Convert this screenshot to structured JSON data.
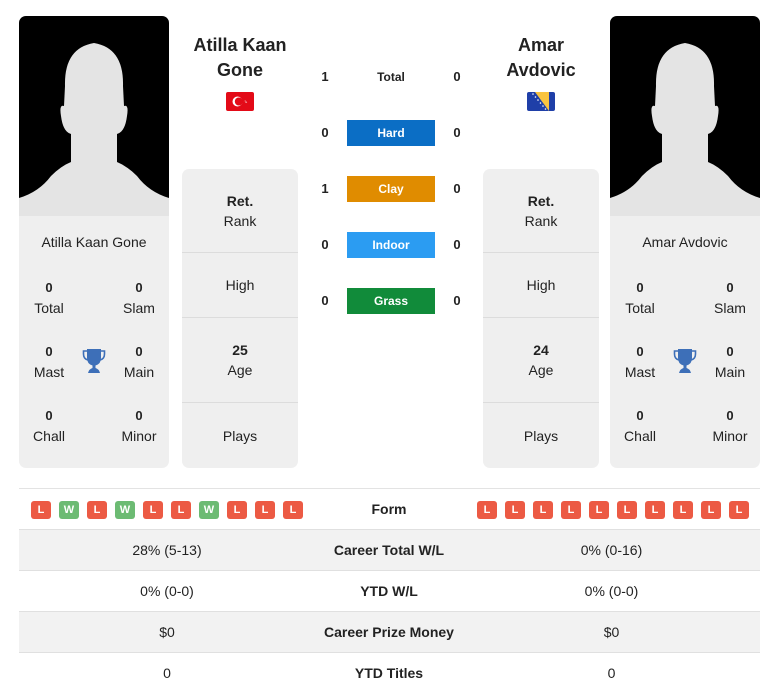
{
  "colors": {
    "hard": "#0b6ec5",
    "clay": "#e08c00",
    "indoor": "#2b9cf2",
    "grass": "#118b3a",
    "loss": "#ec5a44",
    "win": "#6cbb73",
    "trophy": "#3d6fb8"
  },
  "players": {
    "left": {
      "name": "Atilla Kaan Gone",
      "name_line1": "Atilla Kaan",
      "name_line2": "Gone",
      "flag": "turkey-flag",
      "titles": {
        "total": "0",
        "total_label": "Total",
        "slam": "0",
        "slam_label": "Slam",
        "mast": "0",
        "mast_label": "Mast",
        "main": "0",
        "main_label": "Main",
        "chall": "0",
        "chall_label": "Chall",
        "minor": "0",
        "minor_label": "Minor"
      },
      "info": {
        "rank_value": "Ret.",
        "rank_label": "Rank",
        "high_label": "High",
        "age_value": "25",
        "age_label": "Age",
        "plays_label": "Plays"
      },
      "form": [
        "L",
        "W",
        "L",
        "W",
        "L",
        "L",
        "W",
        "L",
        "L",
        "L"
      ]
    },
    "right": {
      "name": "Amar Avdovic",
      "name_line1": "Amar",
      "name_line2": "Avdovic",
      "flag": "bosnia-flag",
      "titles": {
        "total": "0",
        "total_label": "Total",
        "slam": "0",
        "slam_label": "Slam",
        "mast": "0",
        "mast_label": "Mast",
        "main": "0",
        "main_label": "Main",
        "chall": "0",
        "chall_label": "Chall",
        "minor": "0",
        "minor_label": "Minor"
      },
      "info": {
        "rank_value": "Ret.",
        "rank_label": "Rank",
        "high_label": "High",
        "age_value": "24",
        "age_label": "Age",
        "plays_label": "Plays"
      },
      "form": [
        "L",
        "L",
        "L",
        "L",
        "L",
        "L",
        "L",
        "L",
        "L",
        "L"
      ]
    }
  },
  "h2h": [
    {
      "label": "Total",
      "left": "1",
      "right": "0"
    },
    {
      "label": "Hard",
      "left": "0",
      "right": "0"
    },
    {
      "label": "Clay",
      "left": "1",
      "right": "0"
    },
    {
      "label": "Indoor",
      "left": "0",
      "right": "0"
    },
    {
      "label": "Grass",
      "left": "0",
      "right": "0"
    }
  ],
  "stats": [
    {
      "label": "Form",
      "left": "",
      "right": ""
    },
    {
      "label": "Career Total W/L",
      "left": "28% (5-13)",
      "right": "0% (0-16)"
    },
    {
      "label": "YTD W/L",
      "left": "0% (0-0)",
      "right": "0% (0-0)"
    },
    {
      "label": "Career Prize Money",
      "left": "$0",
      "right": "$0"
    },
    {
      "label": "YTD Titles",
      "left": "0",
      "right": "0"
    }
  ]
}
